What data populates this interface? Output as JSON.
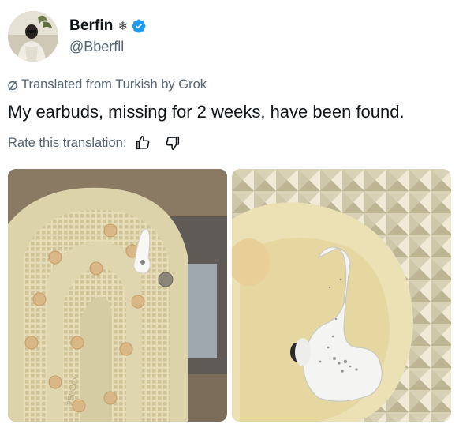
{
  "post": {
    "author": {
      "display_name": "Berfin",
      "name_emoji_icon": "snowflake-icon",
      "verified_badge": "verified-badge-icon",
      "handle": "@Bberfll"
    },
    "translation": {
      "label": "Translated from Turkish by Grok",
      "icon": "translate-icon"
    },
    "text": "My earbuds, missing for 2 weeks, have been found.",
    "rate": {
      "label": "Rate this translation:",
      "thumbs_up_icon": "thumbs-up-icon",
      "thumbs_down_icon": "thumbs-down-icon"
    },
    "media": [
      {
        "name": "earbud-in-shoe-sole-photo",
        "sole_text": "250Cex"
      },
      {
        "name": "earbud-closeup-photo"
      }
    ]
  },
  "colors": {
    "text_primary": "#0f1419",
    "text_secondary": "#536471",
    "verified_blue": "#1d9bf0"
  }
}
